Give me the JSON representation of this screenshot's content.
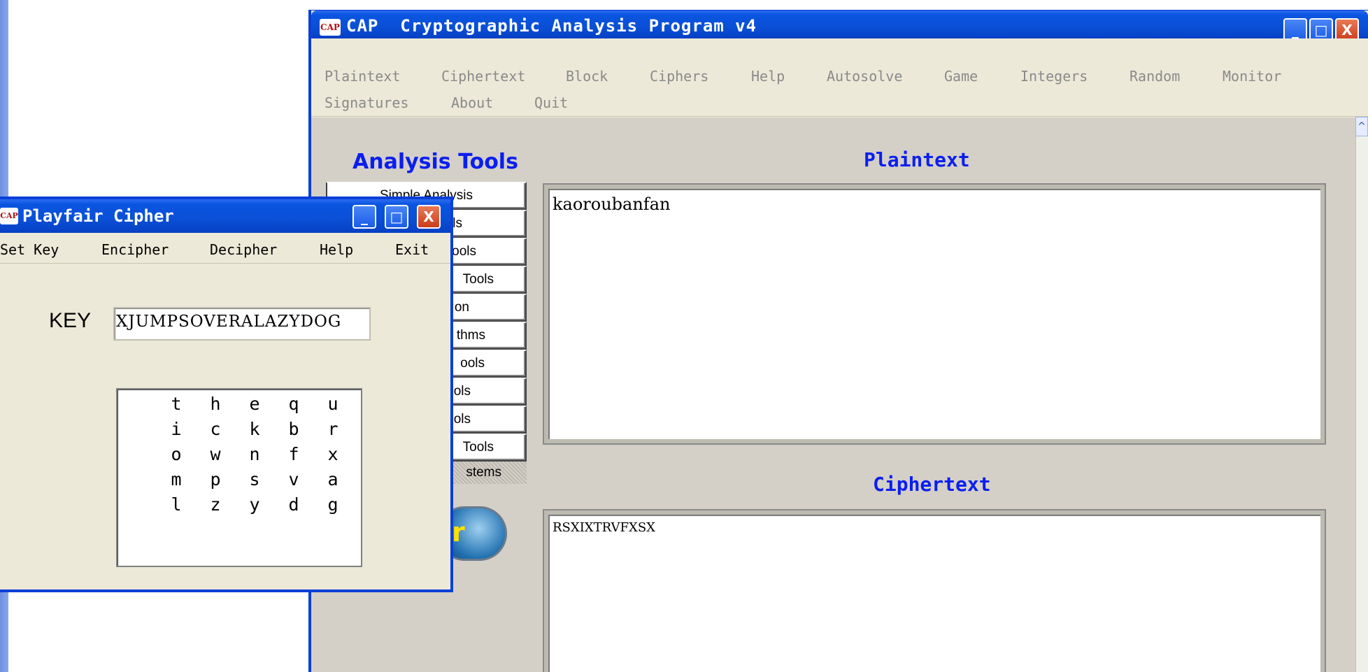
{
  "main_window": {
    "icon": "cap-app-icon",
    "icon_text": "CAP",
    "title": "CAP  Cryptographic Analysis Program v4",
    "buttons": {
      "minimize": "_",
      "maximize": "□",
      "close": "X"
    },
    "menu": [
      "Plaintext",
      "Ciphertext",
      "Block",
      "Ciphers",
      "Help",
      "Autosolve",
      "Game",
      "Integers",
      "Random",
      "Monitor",
      "Signatures",
      "About",
      "Quit"
    ],
    "tools_heading": "Analysis Tools",
    "tools": [
      "Simple Analysis",
      "ls",
      "ools",
      "Tools",
      "on",
      "thms",
      "ools",
      "ols",
      "ols",
      "Tools"
    ],
    "tools_dotted": "stems",
    "logo_glyph": "r",
    "plaintext_label": "Plaintext",
    "plaintext_value": "kaoroubanfan",
    "ciphertext_label": "Ciphertext",
    "ciphertext_value": "RSXIXTRVFXSX",
    "scroll_up_icon": "^"
  },
  "playfair": {
    "icon": "cap-app-icon",
    "icon_text": "CAP",
    "title": "Playfair Cipher",
    "buttons": {
      "minimize": "_",
      "maximize": "□",
      "close": "X"
    },
    "menu": [
      "Set Key",
      "Encipher",
      "Decipher",
      "Help",
      "Exit"
    ],
    "key_label": "KEY",
    "key_value": "XJUMPSOVERALAZYDOG",
    "grid": [
      [
        "t",
        "h",
        "e",
        "q",
        "u"
      ],
      [
        "i",
        "c",
        "k",
        "b",
        "r"
      ],
      [
        "o",
        "w",
        "n",
        "f",
        "x"
      ],
      [
        "m",
        "p",
        "s",
        "v",
        "a"
      ],
      [
        "l",
        "z",
        "y",
        "d",
        "g"
      ]
    ]
  },
  "colors": {
    "titlebar_blue": "#0a4fd6",
    "heading_blue": "#0b1ef0",
    "dialog_bg": "#ece9d8"
  }
}
